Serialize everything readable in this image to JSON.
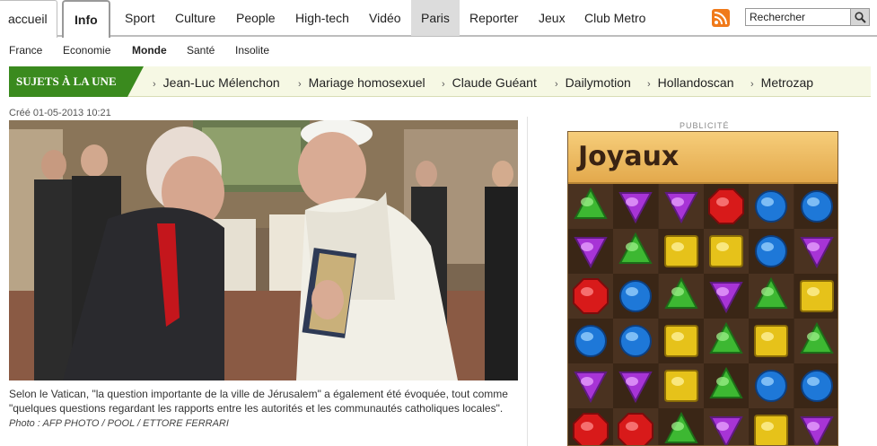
{
  "topnav": {
    "items": [
      "accueil",
      "Info",
      "Sport",
      "Culture",
      "People",
      "High-tech",
      "Vidéo",
      "Paris",
      "Reporter",
      "Jeux",
      "Club Metro"
    ],
    "active": "Info",
    "search_placeholder": "Rechercher"
  },
  "subnav": {
    "items": [
      "France",
      "Economie",
      "Monde",
      "Santé",
      "Insolite"
    ],
    "active": "Monde"
  },
  "subjects": {
    "label": "SUJETS À LA UNE",
    "items": [
      "Jean-Luc Mélenchon",
      "Mariage homosexuel",
      "Claude Guéant",
      "Dailymotion",
      "Hollandoscan",
      "Metrozap"
    ]
  },
  "article": {
    "created": "Créé 01-05-2013 10:21",
    "caption": "Selon le Vatican, \"la question importante de la ville de Jérusalem\" a également été évoquée, tout comme \"quelques questions regardant les rapports entre les autorités et les communautés catholiques locales\".",
    "credit": "Photo : AFP PHOTO / POOL / ETTORE FERRARI"
  },
  "ad": {
    "label": "PUBLICITÉ",
    "title": "Joyaux",
    "gems": [
      [
        "green",
        "purple",
        "purple",
        "red",
        "blue",
        "blue"
      ],
      [
        "purple",
        "green",
        "yellow",
        "yellow",
        "blue",
        "purple"
      ],
      [
        "red",
        "blue",
        "green",
        "purple",
        "green",
        "yellow"
      ],
      [
        "blue",
        "blue",
        "yellow",
        "green",
        "yellow",
        "green"
      ],
      [
        "purple",
        "purple",
        "yellow",
        "green",
        "blue",
        "blue"
      ],
      [
        "red",
        "red",
        "green",
        "purple",
        "yellow",
        "purple"
      ]
    ]
  },
  "colors": {
    "green": "#3a8a1e",
    "paris_bg": "#dcdcdc",
    "rss": "#f07a1b"
  }
}
